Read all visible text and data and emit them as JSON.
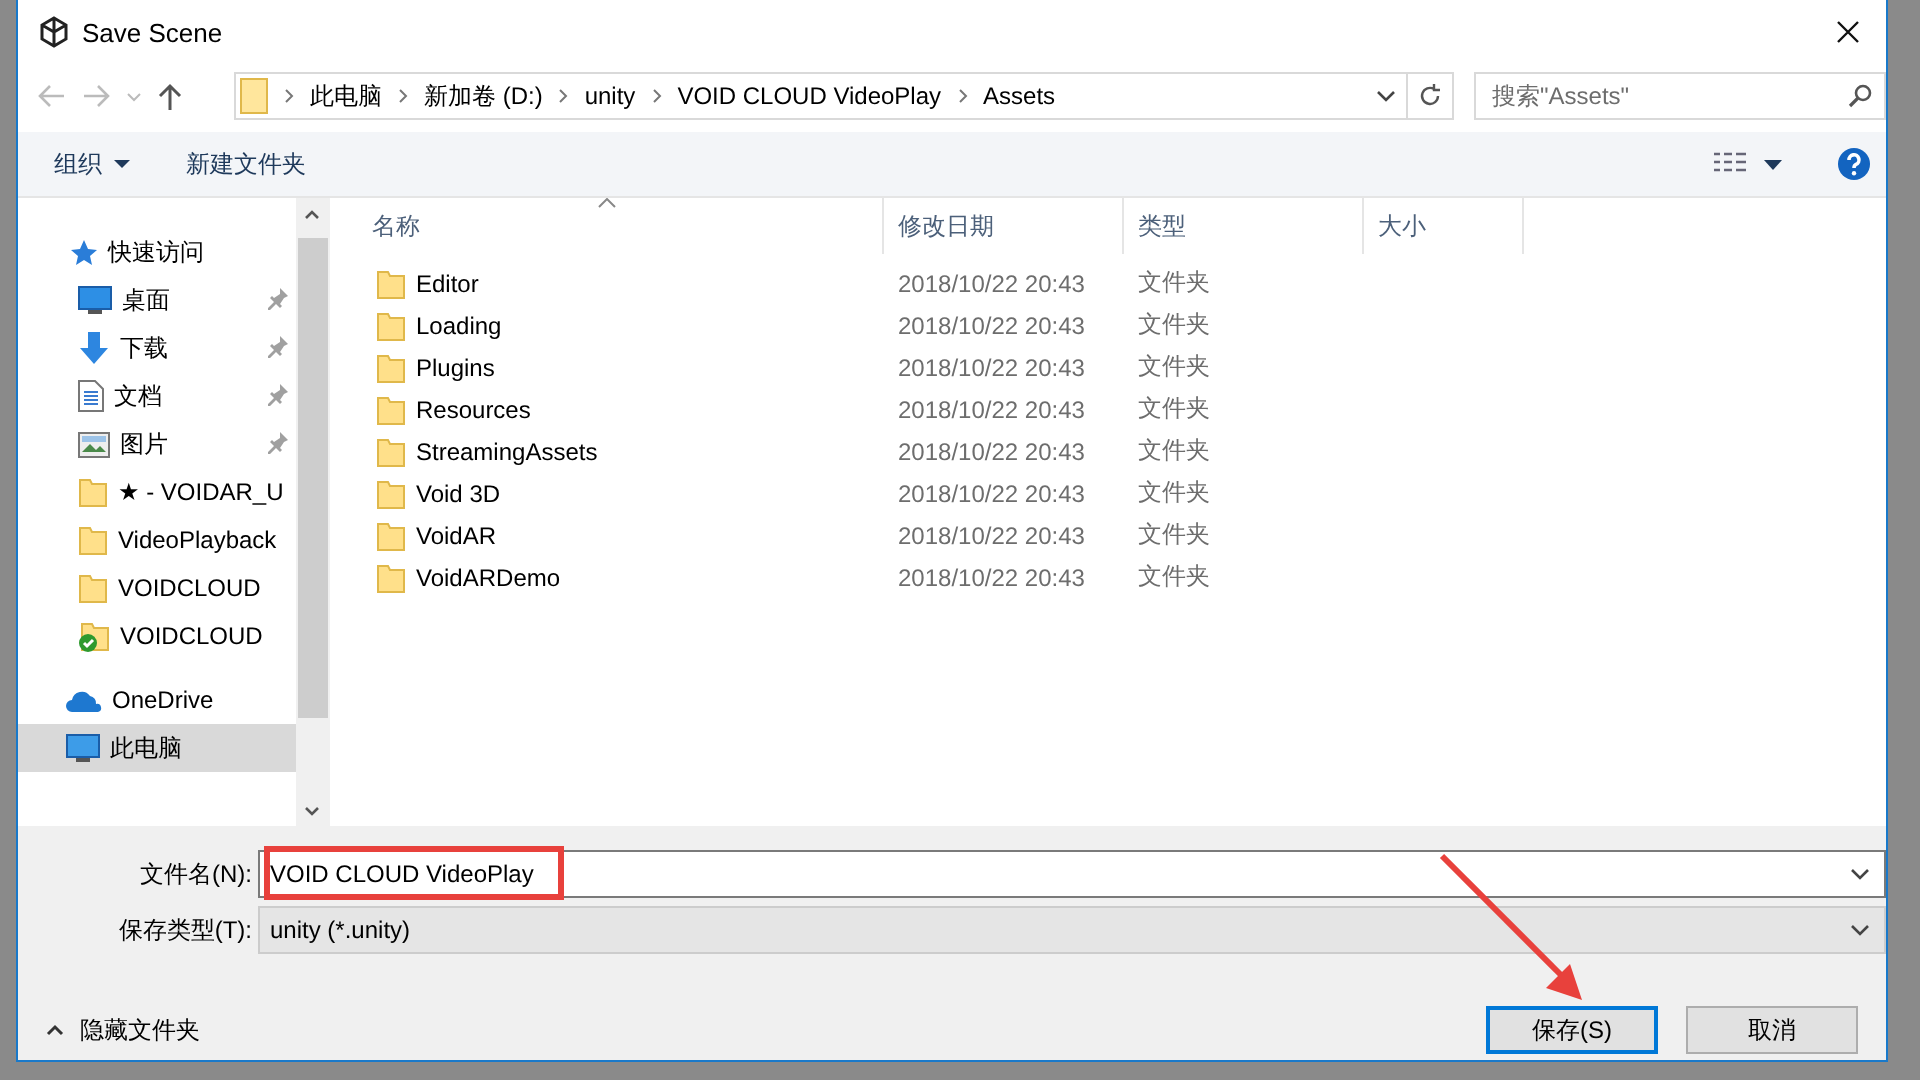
{
  "window": {
    "title": "Save Scene"
  },
  "breadcrumb": [
    "此电脑",
    "新加卷 (D:)",
    "unity",
    "VOID CLOUD VideoPlay",
    "Assets"
  ],
  "search": {
    "placeholder": "搜索\"Assets\""
  },
  "toolbar": {
    "organize": "组织",
    "new_folder": "新建文件夹"
  },
  "nav": [
    {
      "label": "快速访问",
      "kind": "quick",
      "selected": false,
      "children": [
        {
          "label": "桌面",
          "kind": "desktop",
          "pinned": true,
          "selected": false
        },
        {
          "label": "下载",
          "kind": "download",
          "pinned": true,
          "selected": false
        },
        {
          "label": "文档",
          "kind": "document",
          "pinned": true,
          "selected": false
        },
        {
          "label": "图片",
          "kind": "picture",
          "pinned": true,
          "selected": false
        },
        {
          "label": "★ - VOIDAR_U",
          "kind": "folder",
          "pinned": false,
          "selected": false
        },
        {
          "label": "VideoPlayback",
          "kind": "folder",
          "pinned": false,
          "selected": false
        },
        {
          "label": "VOIDCLOUD",
          "kind": "folder",
          "pinned": false,
          "selected": false
        },
        {
          "label": "VOIDCLOUD",
          "kind": "folder-synced",
          "pinned": false,
          "selected": false
        }
      ]
    },
    {
      "label": "OneDrive",
      "kind": "onedrive",
      "selected": false
    },
    {
      "label": "此电脑",
      "kind": "pc",
      "selected": true
    }
  ],
  "table": {
    "columns": [
      {
        "label": "名称",
        "sorted": true
      },
      {
        "label": "修改日期",
        "sorted": false
      },
      {
        "label": "类型",
        "sorted": false
      },
      {
        "label": "大小",
        "sorted": false
      }
    ],
    "rows": [
      {
        "name": "Editor",
        "modified": "2018/10/22 20:43",
        "type": "文件夹"
      },
      {
        "name": "Loading",
        "modified": "2018/10/22 20:43",
        "type": "文件夹"
      },
      {
        "name": "Plugins",
        "modified": "2018/10/22 20:43",
        "type": "文件夹"
      },
      {
        "name": "Resources",
        "modified": "2018/10/22 20:43",
        "type": "文件夹"
      },
      {
        "name": "StreamingAssets",
        "modified": "2018/10/22 20:43",
        "type": "文件夹"
      },
      {
        "name": "Void 3D",
        "modified": "2018/10/22 20:43",
        "type": "文件夹"
      },
      {
        "name": "VoidAR",
        "modified": "2018/10/22 20:43",
        "type": "文件夹"
      },
      {
        "name": "VoidARDemo",
        "modified": "2018/10/22 20:43",
        "type": "文件夹"
      }
    ]
  },
  "filename": {
    "label": "文件名(N):",
    "value": "VOID CLOUD VideoPlay"
  },
  "filetype": {
    "label": "保存类型(T):",
    "value": "unity (*.unity)"
  },
  "hide_folders": "隐藏文件夹",
  "buttons": [
    {
      "label": "保存(S)",
      "default": true
    },
    {
      "label": "取消",
      "default": false
    }
  ]
}
